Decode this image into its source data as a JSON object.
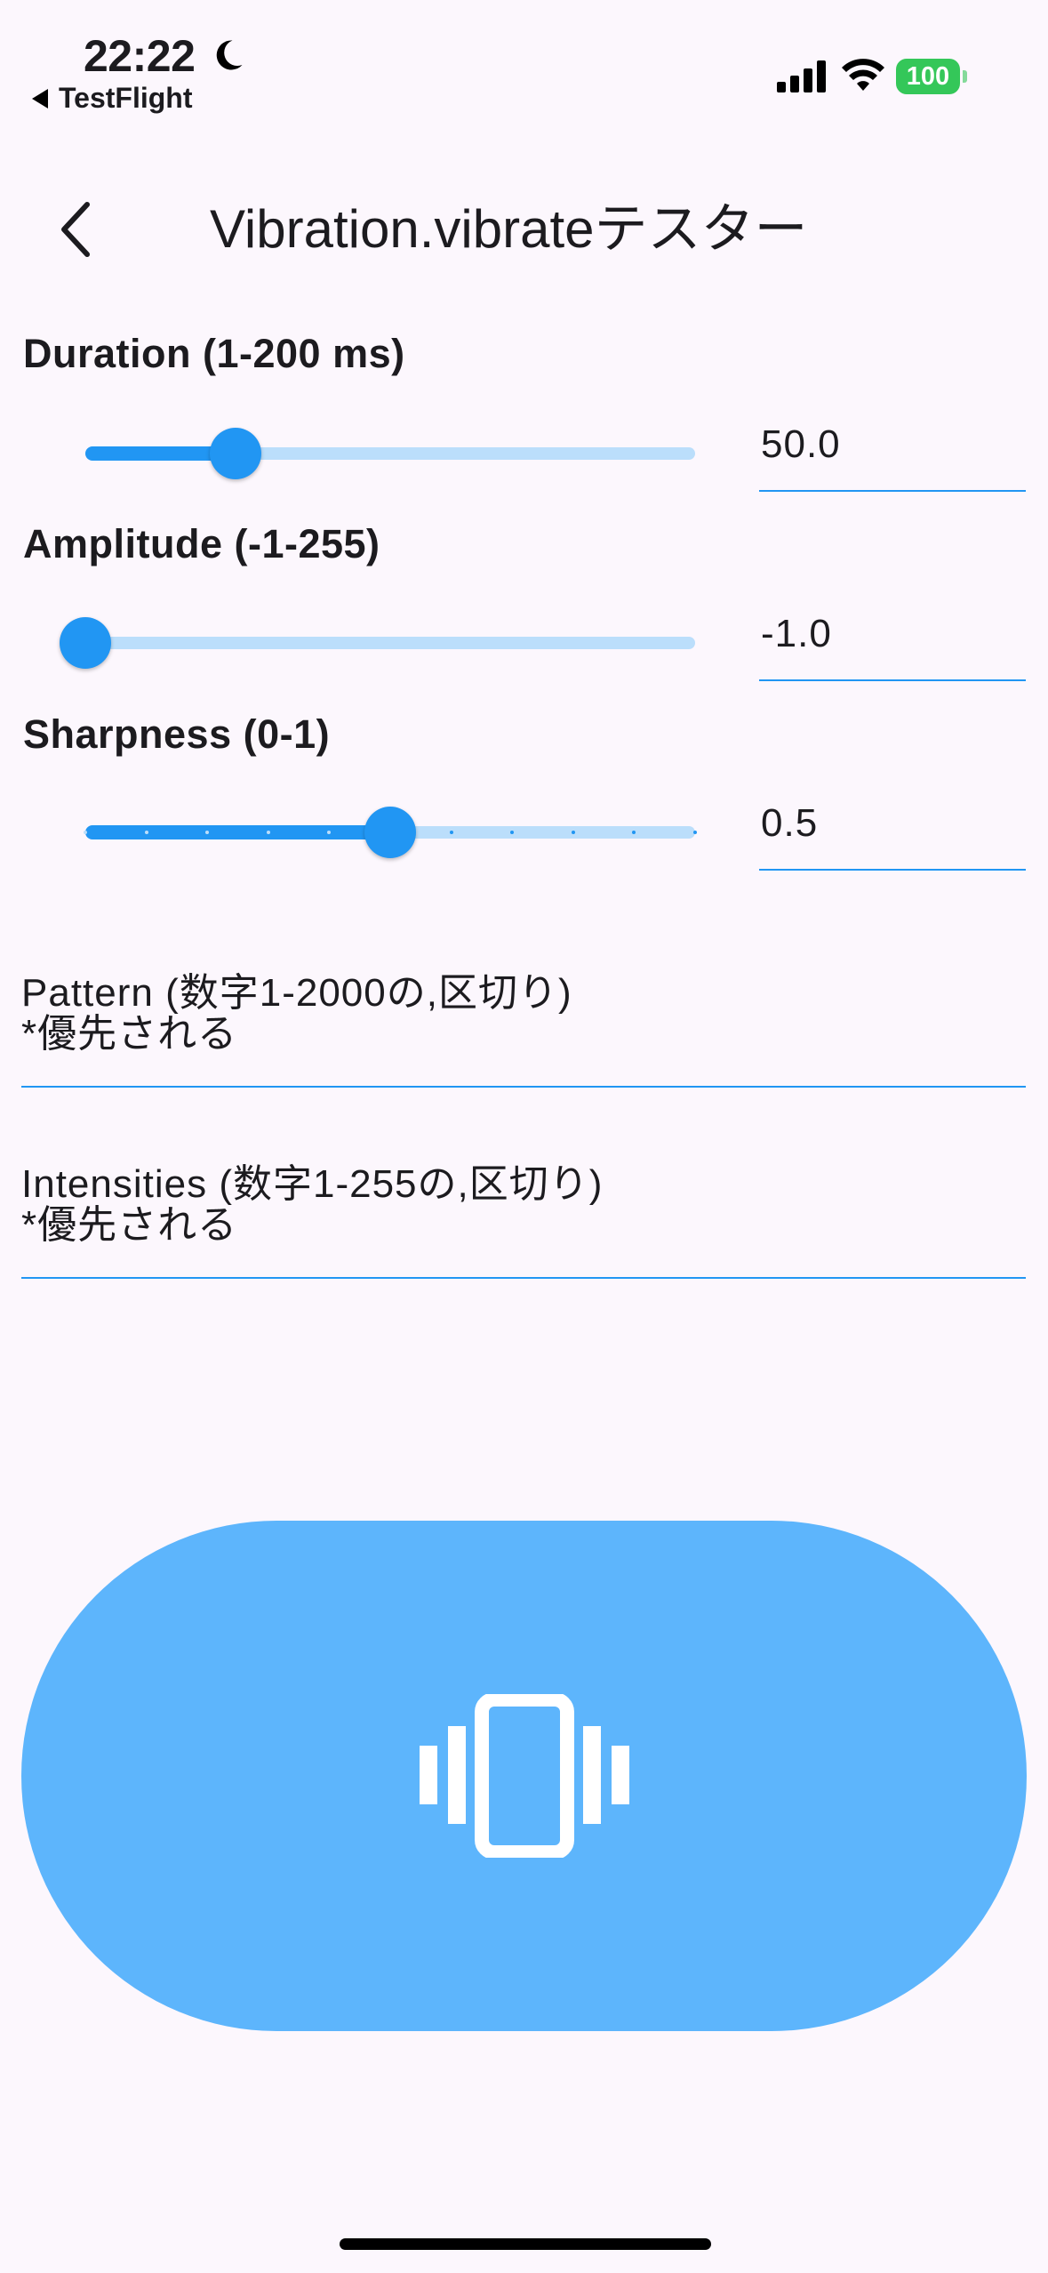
{
  "status_bar": {
    "time": "22:22",
    "back_app": "TestFlight",
    "battery": "100",
    "icons": [
      "moon-icon",
      "cellular-signal-icon",
      "wifi-icon",
      "battery-icon"
    ]
  },
  "app_bar": {
    "title": "Vibration.vibrateテスター",
    "back_icon": "chevron-left-icon"
  },
  "sliders": [
    {
      "label": "Duration (1-200 ms)",
      "value": "50.0",
      "fraction": 0.246
    },
    {
      "label": "Amplitude (-1-255)",
      "value": "-1.0",
      "fraction": 0.0
    },
    {
      "label": "Sharpness (0-1)",
      "value": "0.5",
      "fraction": 0.5,
      "divisions": 10
    }
  ],
  "inputs": {
    "pattern": {
      "line1": "Pattern (数字1-2000の,区切り)",
      "line2": "*優先される"
    },
    "intensities": {
      "line1": "Intensities (数字1-255の,区切り)",
      "line2": "*優先される"
    }
  },
  "vibrate_button": {
    "icon": "vibration-icon"
  },
  "colors": {
    "background": "#fcf7fd",
    "primary": "#2196f3",
    "track_inactive": "#bbdefb",
    "button": "#5db5fc",
    "battery": "#34c759"
  }
}
